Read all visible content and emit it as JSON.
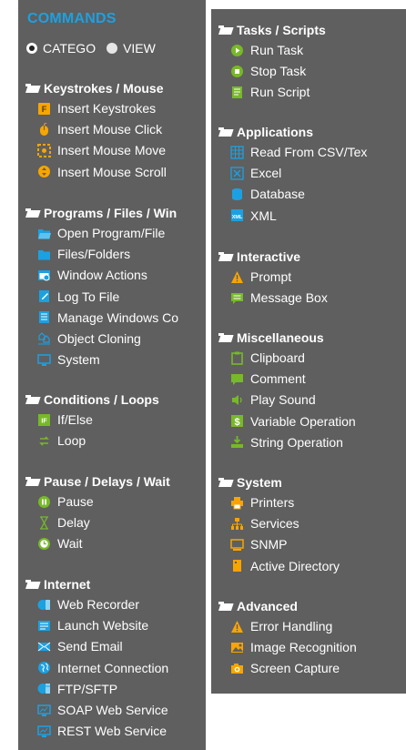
{
  "left": {
    "title": "COMMANDS",
    "radio_category": "CATEGO",
    "radio_view": "VIEW",
    "sections": [
      {
        "label": "Keystrokes / Mouse",
        "items": [
          {
            "label": "Insert Keystrokes",
            "icon": "keystroke-icon"
          },
          {
            "label": "Insert Mouse Click",
            "icon": "mouse-click-icon"
          },
          {
            "label": "Insert Mouse Move",
            "icon": "mouse-move-icon"
          },
          {
            "label": "Insert Mouse Scroll",
            "icon": "mouse-scroll-icon"
          }
        ]
      },
      {
        "label": "Programs / Files / Win",
        "items": [
          {
            "label": "Open Program/File",
            "icon": "open-folder-icon"
          },
          {
            "label": "Files/Folders",
            "icon": "folder-icon"
          },
          {
            "label": "Window Actions",
            "icon": "window-actions-icon"
          },
          {
            "label": "Log To File",
            "icon": "log-file-icon"
          },
          {
            "label": "Manage Windows Co",
            "icon": "manage-windows-icon"
          },
          {
            "label": "Object Cloning",
            "icon": "object-cloning-icon"
          },
          {
            "label": "System",
            "icon": "monitor-icon"
          }
        ]
      },
      {
        "label": "Conditions / Loops",
        "items": [
          {
            "label": "If/Else",
            "icon": "if-else-icon"
          },
          {
            "label": "Loop",
            "icon": "loop-icon"
          }
        ]
      },
      {
        "label": "Pause / Delays / Wait",
        "items": [
          {
            "label": "Pause",
            "icon": "pause-icon"
          },
          {
            "label": "Delay",
            "icon": "hourglass-icon"
          },
          {
            "label": "Wait",
            "icon": "clock-icon"
          }
        ]
      },
      {
        "label": "Internet",
        "items": [
          {
            "label": "Web Recorder",
            "icon": "web-recorder-icon"
          },
          {
            "label": "Launch Website",
            "icon": "launch-website-icon"
          },
          {
            "label": "Send Email",
            "icon": "email-icon"
          },
          {
            "label": "Internet Connection",
            "icon": "globe-icon"
          },
          {
            "label": "FTP/SFTP",
            "icon": "ftp-icon"
          },
          {
            "label": "SOAP Web Service",
            "icon": "soap-icon"
          },
          {
            "label": "REST Web Service",
            "icon": "rest-icon"
          }
        ]
      }
    ]
  },
  "right": {
    "sections": [
      {
        "label": "Tasks / Scripts",
        "items": [
          {
            "label": "Run Task",
            "icon": "play-icon"
          },
          {
            "label": "Stop Task",
            "icon": "stop-icon"
          },
          {
            "label": "Run Script",
            "icon": "script-icon"
          }
        ]
      },
      {
        "label": "Applications",
        "items": [
          {
            "label": "Read From CSV/Tex",
            "icon": "csv-icon"
          },
          {
            "label": "Excel",
            "icon": "excel-icon"
          },
          {
            "label": "Database",
            "icon": "database-icon"
          },
          {
            "label": "XML",
            "icon": "xml-icon"
          }
        ]
      },
      {
        "label": "Interactive",
        "items": [
          {
            "label": "Prompt",
            "icon": "warning-icon"
          },
          {
            "label": "Message Box",
            "icon": "message-box-icon"
          }
        ]
      },
      {
        "label": "Miscellaneous",
        "items": [
          {
            "label": "Clipboard",
            "icon": "clipboard-icon"
          },
          {
            "label": "Comment",
            "icon": "comment-icon"
          },
          {
            "label": "Play Sound",
            "icon": "speaker-icon"
          },
          {
            "label": "Variable Operation",
            "icon": "variable-icon"
          },
          {
            "label": "String Operation",
            "icon": "string-icon"
          }
        ]
      },
      {
        "label": "System",
        "items": [
          {
            "label": "Printers",
            "icon": "printer-icon"
          },
          {
            "label": "Services",
            "icon": "services-icon"
          },
          {
            "label": "SNMP",
            "icon": "snmp-icon"
          },
          {
            "label": "Active Directory",
            "icon": "active-directory-icon"
          }
        ]
      },
      {
        "label": "Advanced",
        "items": [
          {
            "label": "Error Handling",
            "icon": "warning-icon"
          },
          {
            "label": "Image Recognition",
            "icon": "image-recognition-icon"
          },
          {
            "label": "Screen Capture",
            "icon": "camera-icon"
          }
        ]
      }
    ]
  }
}
